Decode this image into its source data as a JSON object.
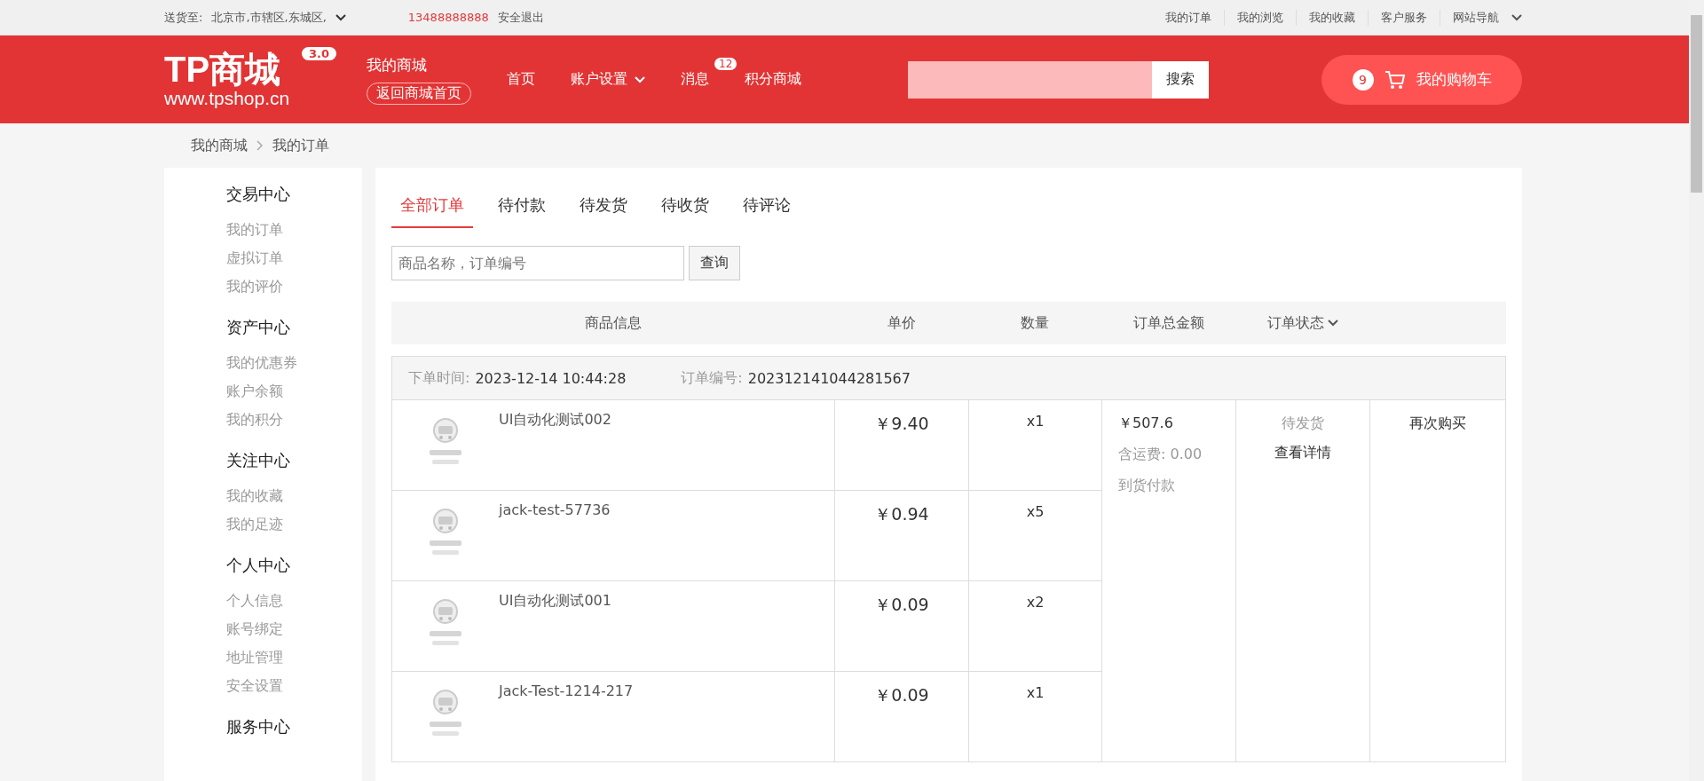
{
  "topbar": {
    "ship_label": "送货至:",
    "location": "北京市,市辖区,东城区,",
    "phone": "13488888888",
    "logout": "安全退出",
    "links": [
      "我的订单",
      "我的浏览",
      "我的收藏",
      "客户服务",
      "网站导航"
    ]
  },
  "header": {
    "logo": "TP商城",
    "logo_version": "3.0",
    "logo_url": "www.tpshop.cn",
    "my_mall": "我的商城",
    "back_home": "返回商城首页",
    "nav": [
      {
        "label": "首页",
        "kind": "plain"
      },
      {
        "label": "账户设置",
        "kind": "dropdown"
      },
      {
        "label": "消息",
        "kind": "badge",
        "badge": "12"
      },
      {
        "label": "积分商城",
        "kind": "plain"
      }
    ],
    "search_button": "搜索",
    "cart_count": "9",
    "cart_label": "我的购物车"
  },
  "breadcrumb": [
    "我的商城",
    "我的订单"
  ],
  "sidebar": [
    {
      "title": "交易中心",
      "items": [
        "我的订单",
        "虚拟订单",
        "我的评价"
      ]
    },
    {
      "title": "资产中心",
      "items": [
        "我的优惠券",
        "账户余额",
        "我的积分"
      ]
    },
    {
      "title": "关注中心",
      "items": [
        "我的收藏",
        "我的足迹"
      ]
    },
    {
      "title": "个人中心",
      "items": [
        "个人信息",
        "账号绑定",
        "地址管理",
        "安全设置"
      ]
    },
    {
      "title": "服务中心"
    }
  ],
  "tabs": [
    {
      "label": "全部订单",
      "selected": true
    },
    {
      "label": "待付款",
      "selected": false
    },
    {
      "label": "待发货",
      "selected": false
    },
    {
      "label": "待收货",
      "selected": false
    },
    {
      "label": "待评论",
      "selected": false
    }
  ],
  "order_search": {
    "placeholder": "商品名称，订单编号",
    "button": "查询"
  },
  "table": {
    "columns": [
      "商品信息",
      "单价",
      "数量",
      "订单总金额",
      "订单状态"
    ],
    "order": {
      "time_label": "下单时间:",
      "time": "2023-12-14 10:44:28",
      "number_label": "订单编号:",
      "number": "202312141044281567",
      "items": [
        {
          "name": "UI自动化测试002",
          "price": "￥9.40",
          "qty": "x1"
        },
        {
          "name": "jack-test-57736",
          "price": "￥0.94",
          "qty": "x5"
        },
        {
          "name": "UI自动化测试001",
          "price": "￥0.09",
          "qty": "x2"
        },
        {
          "name": "Jack-Test-1214-217",
          "price": "￥0.09",
          "qty": "x1"
        }
      ],
      "total": "￥507.6",
      "shipping_label": "含运费:",
      "shipping": "0.00",
      "payment": "到货付款",
      "status": "待发货",
      "details": "查看详情",
      "rebuy": "再次购买"
    }
  }
}
